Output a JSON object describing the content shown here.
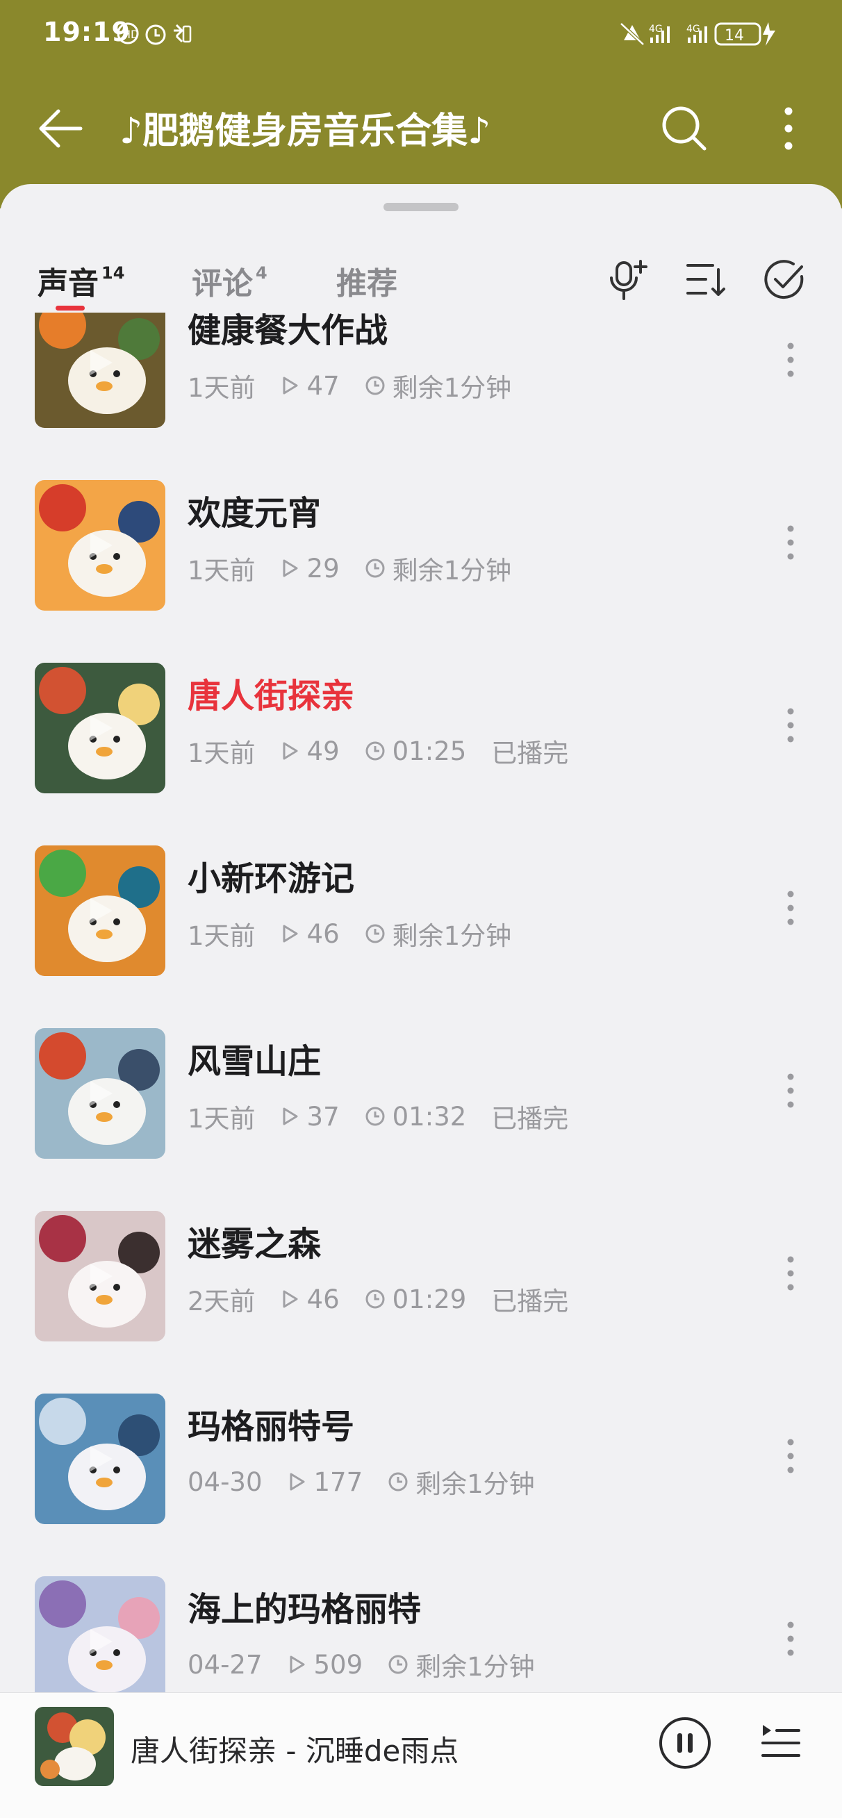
{
  "status": {
    "time": "19:19",
    "battery": "14",
    "network": "4G"
  },
  "header": {
    "title": "♪肥鹅健身房音乐合集♪"
  },
  "tabs": [
    {
      "label": "声音",
      "count": "14"
    },
    {
      "label": "评论",
      "count": "4"
    },
    {
      "label": "推荐",
      "count": ""
    }
  ],
  "tracks": [
    {
      "title": "健康餐大作战",
      "date": "1天前",
      "plays": "47",
      "duration": "剩余1分钟",
      "played": ""
    },
    {
      "title": "欢度元宵",
      "date": "1天前",
      "plays": "29",
      "duration": "剩余1分钟",
      "played": ""
    },
    {
      "title": "唐人街探亲",
      "date": "1天前",
      "plays": "49",
      "duration": "01:25",
      "played": "已播完"
    },
    {
      "title": "小新环游记",
      "date": "1天前",
      "plays": "46",
      "duration": "剩余1分钟",
      "played": ""
    },
    {
      "title": "风雪山庄",
      "date": "1天前",
      "plays": "37",
      "duration": "01:32",
      "played": "已播完"
    },
    {
      "title": "迷雾之森",
      "date": "2天前",
      "plays": "46",
      "duration": "01:29",
      "played": "已播完"
    },
    {
      "title": "玛格丽特号",
      "date": "04-30",
      "plays": "177",
      "duration": "剩余1分钟",
      "played": ""
    },
    {
      "title": "海上的玛格丽特",
      "date": "04-27",
      "plays": "509",
      "duration": "剩余1分钟",
      "played": ""
    }
  ],
  "now_playing": {
    "text": "唐人街探亲 - 沉睡de雨点"
  },
  "colors": {
    "header_bg": "#8a882c",
    "accent": "#e8333c",
    "sheet_bg": "#f1f1f3"
  }
}
